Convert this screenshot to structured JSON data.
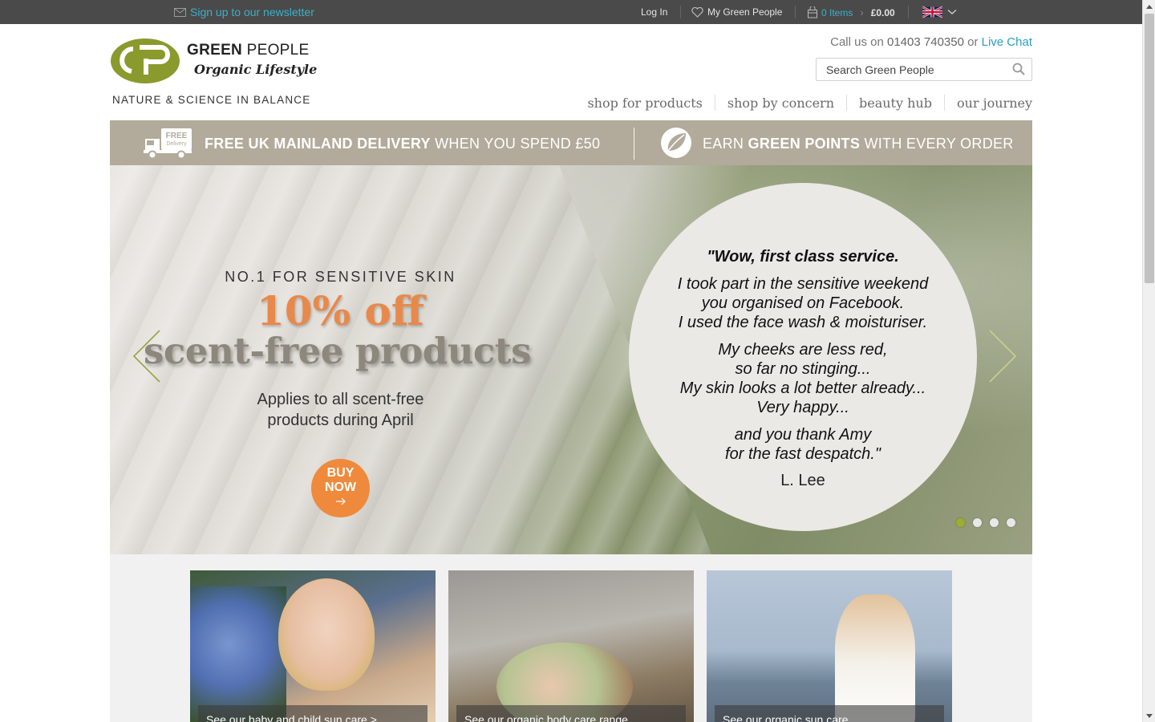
{
  "topbar": {
    "newsletter": "Sign up to our newsletter",
    "login": "Log In",
    "my_green_people": "My Green People",
    "basket_items": "0 Items",
    "basket_total": "£0.00"
  },
  "header": {
    "brand_green": "GREEN",
    "brand_people": " PEOPLE",
    "brand_sub": "Organic Lifestyle",
    "tagline": "NATURE & SCIENCE IN BALANCE",
    "call_prefix": "Call us on ",
    "phone": "01403 740350",
    "call_or": " or ",
    "live_chat": "Live Chat",
    "search_placeholder": "Search Green People"
  },
  "nav": {
    "items": [
      {
        "label": "shop for products"
      },
      {
        "label": "shop by concern"
      },
      {
        "label": "beauty hub"
      },
      {
        "label": "our journey"
      }
    ]
  },
  "promo": {
    "delivery_bold": "FREE UK MAINLAND DELIVERY",
    "delivery_rest": " WHEN YOU SPEND £50",
    "truck_badge_1": "FREE",
    "truck_badge_2": "Delivery",
    "points_pre": "EARN ",
    "points_bold": "GREEN POINTS",
    "points_rest": " WITH EVERY ORDER"
  },
  "hero": {
    "kicker": "NO.1 FOR SENSITIVE SKIN",
    "offer": "10% off",
    "title": "scent-free products",
    "desc_1": "Applies to all scent-free",
    "desc_2": "products during April",
    "buy_1": "BUY",
    "buy_2": "NOW",
    "quote_1": "\"Wow, first class service.",
    "quote_2a": "I took part in the sensitive weekend",
    "quote_2b": "you organised on Facebook.",
    "quote_2c": "I used the face wash & moisturiser.",
    "quote_3a": "My cheeks are less red,",
    "quote_3b": "so far no stinging...",
    "quote_3c": "My skin looks a lot better already...",
    "quote_3d": "Very happy...",
    "quote_4a": "and you thank Amy",
    "quote_4b": "for the fast despatch.\"",
    "author": "L. Lee",
    "active_slide": 1,
    "slide_count": 4
  },
  "tiles": [
    {
      "caption": "See our baby and child sun care >"
    },
    {
      "caption": "See our organic body care range"
    },
    {
      "caption": "See our organic sun care"
    }
  ],
  "colors": {
    "topbar": "#4a4a4a",
    "promo": "#b2aa9a",
    "accent_orange": "#ef8a3c",
    "link_blue": "#2a9fc0",
    "logo_green": "#8a9a2c"
  }
}
